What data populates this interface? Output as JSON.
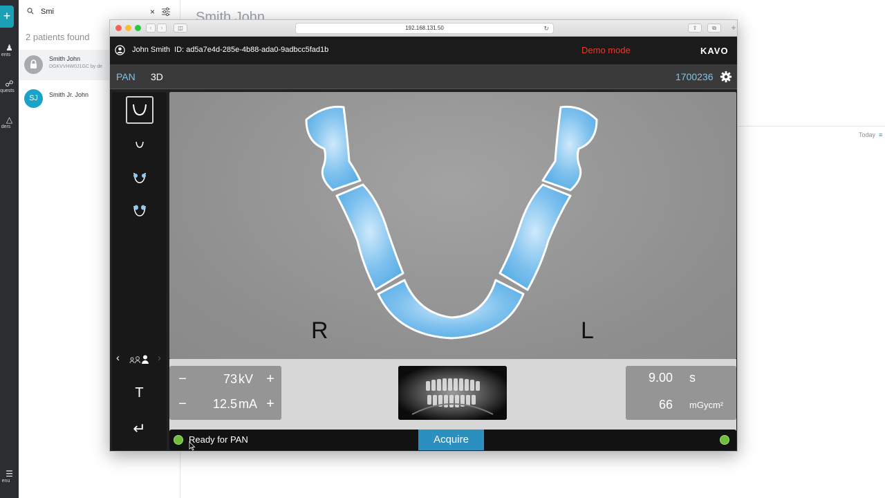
{
  "left_rail": {
    "add_label": "+",
    "items": [
      {
        "label": "ents",
        "icon": "patients-icon"
      },
      {
        "label": "equests",
        "icon": "requests-icon"
      },
      {
        "label": "ders",
        "icon": "orders-icon"
      }
    ],
    "menu": {
      "label": "enu",
      "icon": "menu-icon"
    }
  },
  "patients_panel": {
    "search_value": "Smi",
    "clear_label": "×",
    "found_text": "2 patients found",
    "patients": [
      {
        "name": "Smith John",
        "sub": "DGKVVHW0J1GC by de",
        "avatar": "lock",
        "avatar_color": "#a7abb0"
      },
      {
        "name": "Smith Jr. John",
        "initials": "SJ",
        "avatar_color": "#1aa3c7"
      }
    ]
  },
  "detail": {
    "title": "Smith John",
    "today_label": "Today"
  },
  "browser": {
    "url": "192.168.131.50"
  },
  "app": {
    "user_name": "John Smith",
    "user_id": "ID: ad5a7e4d-285e-4b88-ada0-9adbcc5fad1b",
    "demo_mode": "Demo mode",
    "logo": "KAVO",
    "tabs": [
      {
        "label": "PAN",
        "active": true
      },
      {
        "label": "3D",
        "active": false
      }
    ],
    "device_id": "1700236",
    "tools": {
      "t_label": "T",
      "tools_list": [
        "full-arch-icon",
        "half-arch-icon",
        "tmj-icon",
        "sinus-icon"
      ],
      "patient_size": "adult"
    },
    "viewer": {
      "left_letter": "R",
      "right_letter": "L"
    },
    "params": {
      "kv_value": "73",
      "kv_unit": "kV",
      "ma_value": "12.5",
      "ma_unit": "mA",
      "minus": "−",
      "plus": "+",
      "time_value": "9.00",
      "time_unit": "s",
      "dose_value": "66",
      "dose_unit": "mGycm²"
    },
    "status": {
      "text": "Ready for PAN",
      "acquire_label": "Acquire",
      "led_color": "#6fbd3b"
    },
    "colors": {
      "accent": "#2b8fbf",
      "arch_fill": "#8fc8ef",
      "demo": "#e33b2e"
    }
  }
}
